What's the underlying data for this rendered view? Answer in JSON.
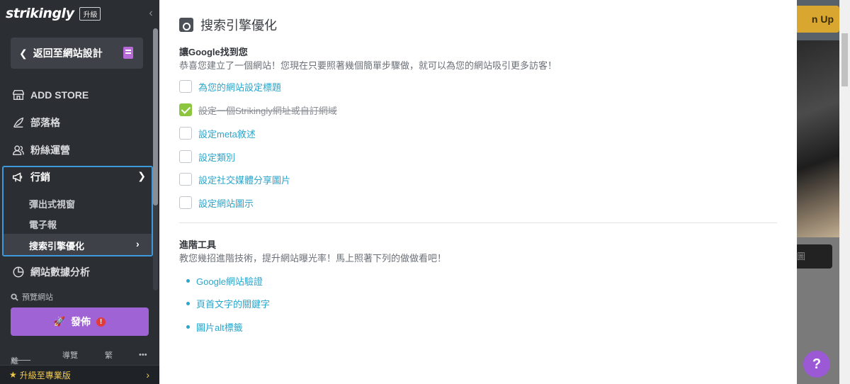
{
  "sidebar": {
    "logo": "strikingly",
    "upgrade_badge": "升級",
    "back_button": "返回至網站設計",
    "nav": {
      "add_store": "ADD STORE",
      "blog": "部落格",
      "fans": "粉絲運營",
      "marketing": "行銷",
      "analytics": "網站數據分析"
    },
    "marketing_sub": {
      "popup": "彈出式視窗",
      "newsletter": "電子報",
      "seo": "搜索引擎優化"
    },
    "preview_site": "預覽網站",
    "publish_button": "發佈",
    "publish_alert": "!",
    "bottom": {
      "leave": "離開",
      "guide": "導覽",
      "lang": "繁",
      "more": "•••"
    },
    "upgrade_pro": "升級至專業版"
  },
  "panel": {
    "title": "搜索引擎優化",
    "section1": {
      "title": "讓Google找到您",
      "description": "恭喜您建立了一個網站！您現在只要照著幾個簡單步驟做，就可以為您的網站吸引更多訪客！",
      "checklist": [
        {
          "label": "為您的網站設定標題",
          "checked": false
        },
        {
          "label": "設定一個Strikingly網址或自訂網域",
          "checked": true
        },
        {
          "label": "設定meta敘述",
          "checked": false
        },
        {
          "label": "設定類別",
          "checked": false
        },
        {
          "label": "設定社交媒體分享圖片",
          "checked": false
        },
        {
          "label": "設定網站圖示",
          "checked": false
        }
      ]
    },
    "section2": {
      "title": "進階工具",
      "description": "教您幾招進階技術，提升網站曝光率！馬上照著下列的做做看吧！",
      "links": [
        "Google網站驗證",
        "頁首文字的關鍵字",
        "圖片alt標籤"
      ]
    }
  },
  "background": {
    "signup_partial": "n Up",
    "dark_button_partial": "圖",
    "help_button": "?"
  }
}
